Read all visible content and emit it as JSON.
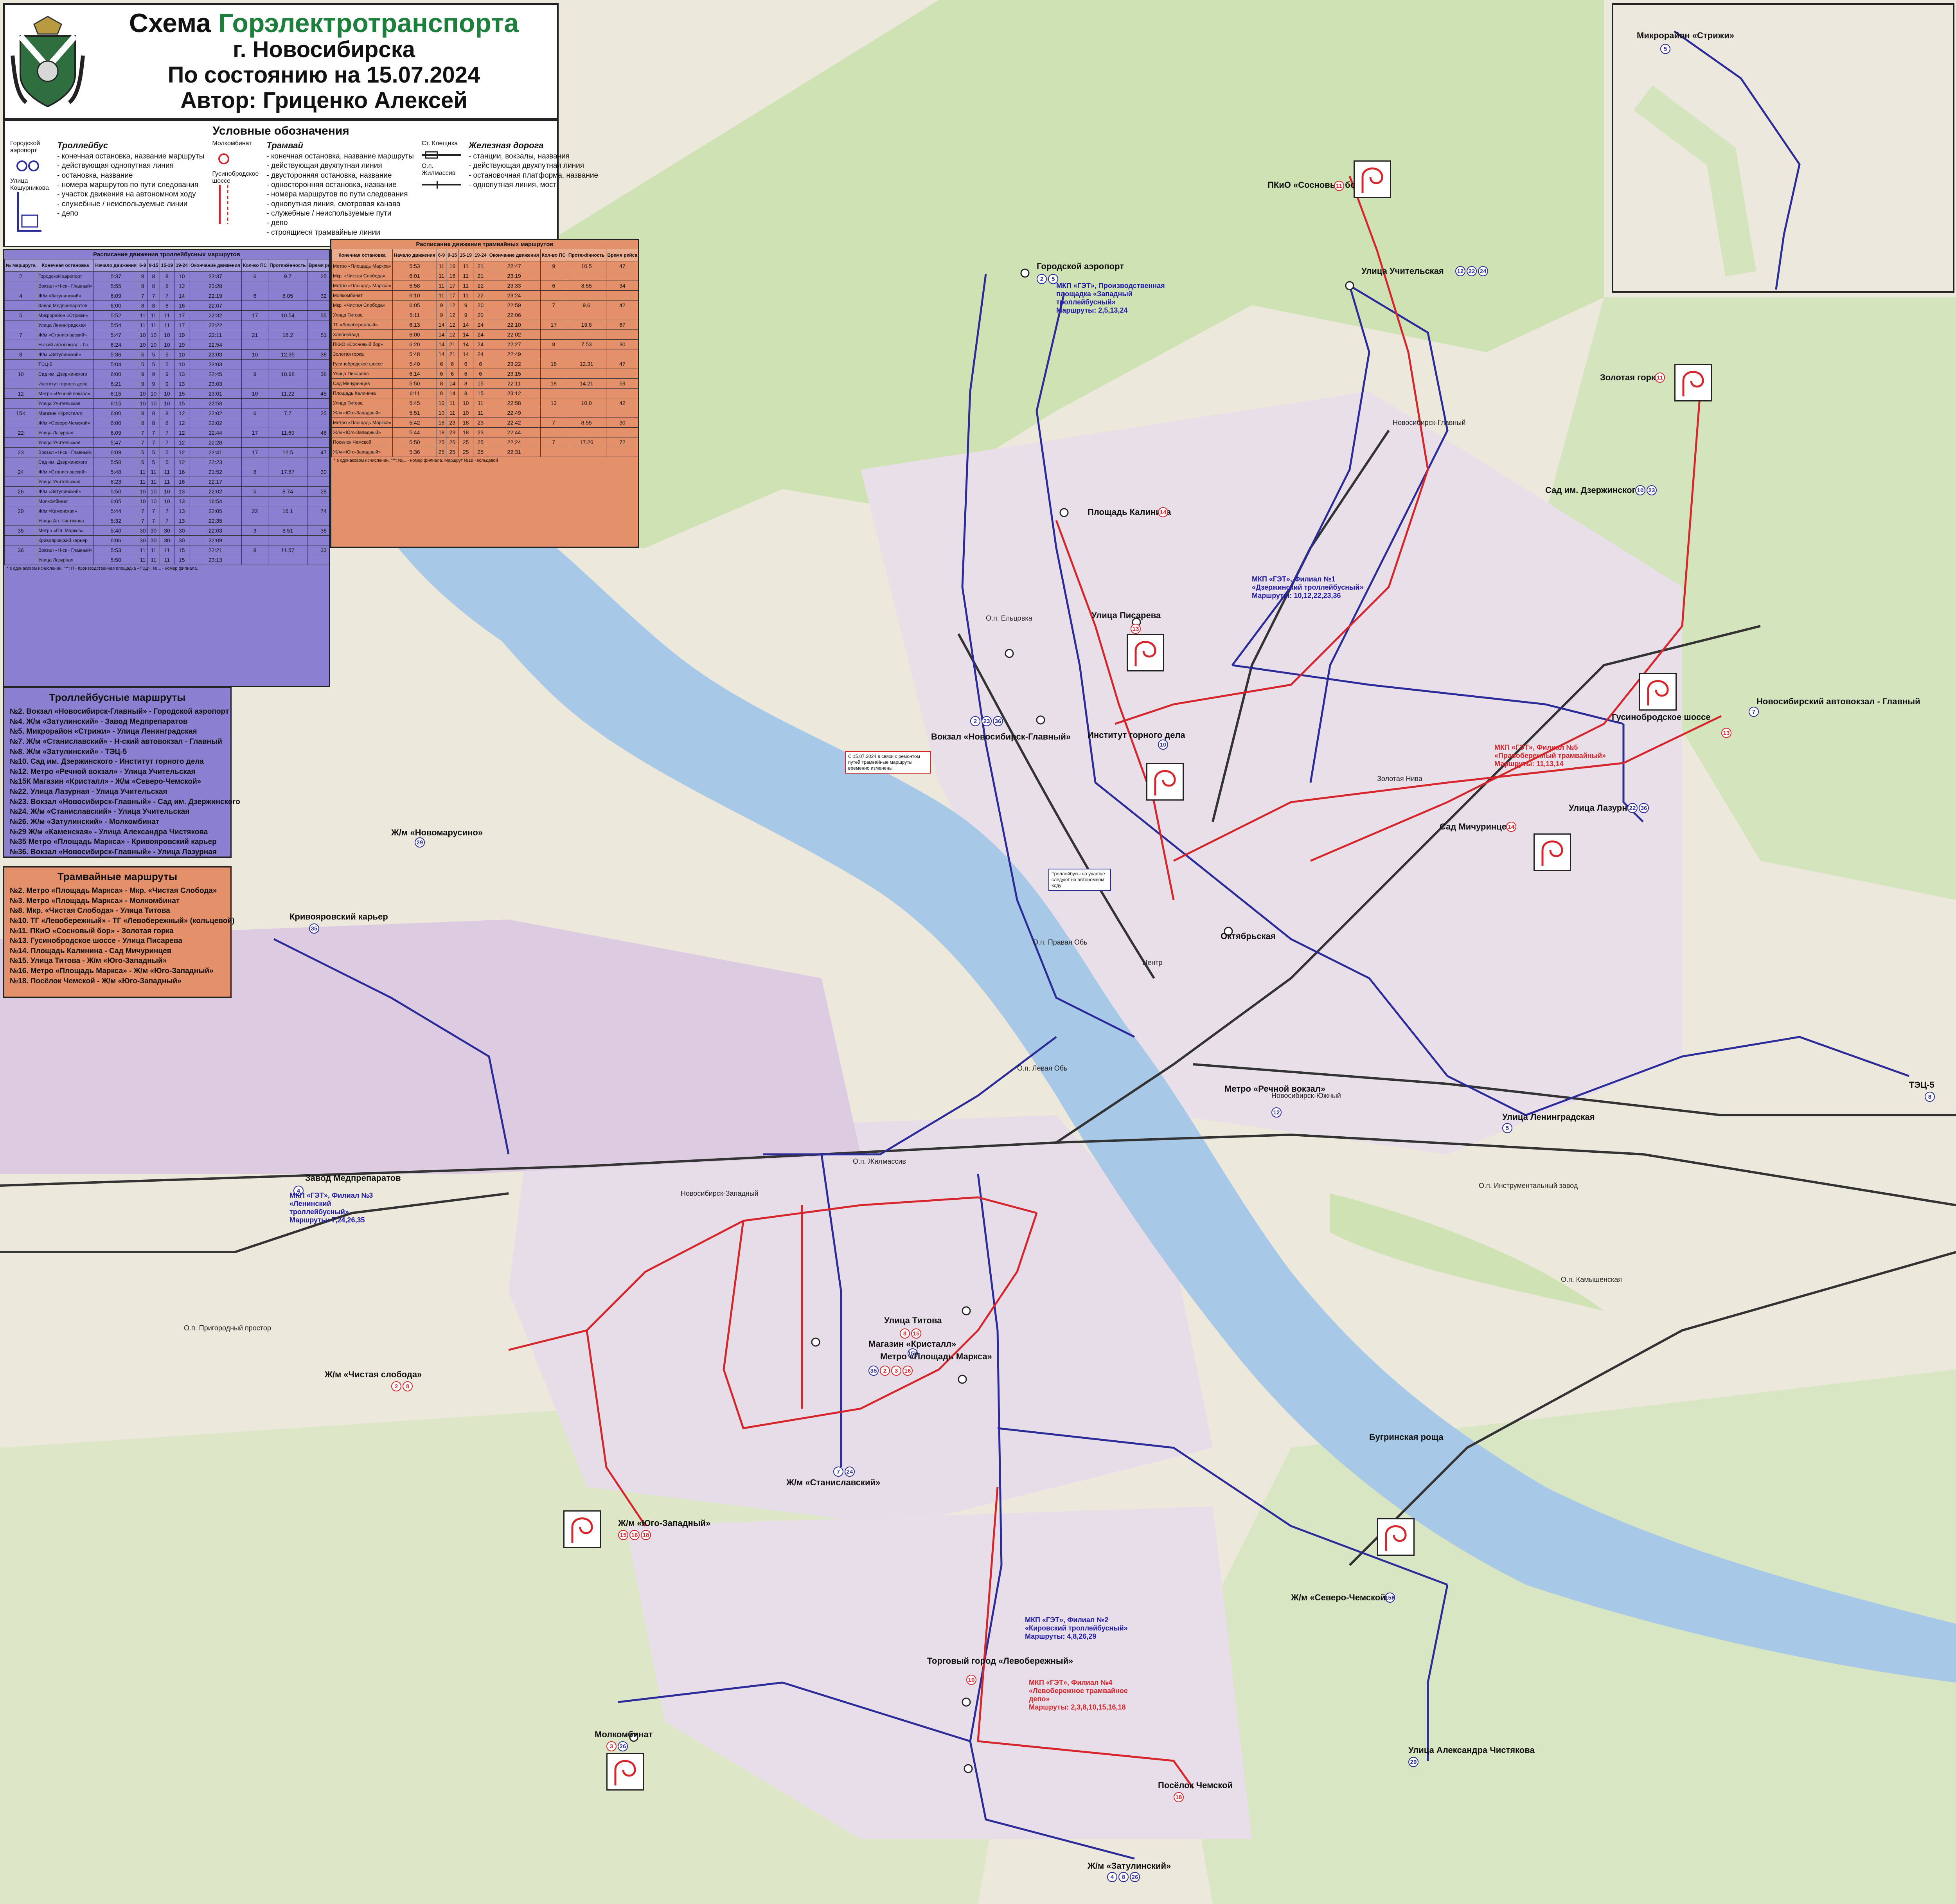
{
  "title": {
    "line1_prefix": "Схема ",
    "line1_accent": "Горэлектротранспорта",
    "line2": "г. Новосибирска",
    "line3": "По состоянию на 15.07.2024",
    "line4": "Автор: Гриценко Алексей"
  },
  "legend": {
    "title": "Условные обозначения",
    "trolleybus": {
      "head": "Троллейбус",
      "items": [
        "- конечная остановка, название маршруты",
        "- действующая однопутная линия",
        "- остановка, название",
        "- номера маршрутов по пути следования",
        "- участок движения на автономном ходу",
        "- служебные / неиспользуемые линии",
        "- депо"
      ],
      "sample_stop": "Городской аэропорт",
      "sample_street": "Улица Кошурникова"
    },
    "tram": {
      "head": "Трамвай",
      "items": [
        "- конечная остановка, название маршруты",
        "- действующая двухпутная линия",
        "- двусторонняя остановка, название",
        "- односторонняя остановка, название",
        "- номера маршрутов по пути следования",
        "- однопутная линия, смотровая канава",
        "- служебные / неиспользуемые пути",
        "- депо",
        "- строящиеся трамвайные линии"
      ],
      "sample_stop": "Молкомбинат",
      "sample_street": "Гусинобродское шоссе"
    },
    "railway": {
      "head": "Железная дорога",
      "items": [
        "- станции, вокзалы, названия",
        "- действующая двухпутная линия",
        "- остановочная платформа, название",
        "- однопутная линия, мост"
      ],
      "sample_station": "Ст. Клещиха",
      "sample_platform": "О.п. Жилмассив"
    }
  },
  "trolley_schedule": {
    "title": "Расписание движения троллейбусных маршрутов",
    "headers": [
      "№ маршрута",
      "Конечная остановка",
      "Начало движения",
      "6-9",
      "9-15",
      "15-19",
      "19-24",
      "Окончание движения",
      "Кол-во ПС",
      "Протяжённость",
      "Время рейса",
      "Депо"
    ],
    "rows": [
      [
        "2",
        "Городской аэропорт",
        "5:37",
        "8",
        "8",
        "8",
        "10",
        "22:37",
        "6",
        "9.7",
        "25",
        "№1"
      ],
      [
        "",
        "Вокзал «Н-ск - Главный»",
        "5:55",
        "8",
        "8",
        "8",
        "12",
        "23:28",
        "",
        "",
        "",
        ""
      ],
      [
        "4",
        "Ж/м «Затулинский»",
        "6:09",
        "7",
        "7",
        "7",
        "14",
        "22:19",
        "6",
        "8.05",
        "32",
        "№4"
      ],
      [
        "",
        "Завод Медпрепаратов",
        "6:00",
        "8",
        "8",
        "8",
        "18",
        "22:07",
        "",
        "",
        "",
        ""
      ],
      [
        "5",
        "Микрорайон «Стрижи»",
        "5:52",
        "11",
        "11",
        "11",
        "17",
        "22:32",
        "17",
        "10.54",
        "55",
        "№3"
      ],
      [
        "",
        "Улица Ленинградская",
        "5:54",
        "11",
        "11",
        "11",
        "17",
        "22:22",
        "",
        "",
        "",
        ""
      ],
      [
        "7",
        "Ж/м «Станиславский»",
        "5:47",
        "10",
        "10",
        "10",
        "19",
        "22:11",
        "21",
        "18.2",
        "51",
        "№1"
      ],
      [
        "",
        "Н-ский автовокзал - Гл.",
        "6:24",
        "10",
        "10",
        "10",
        "19",
        "22:54",
        "",
        "",
        "",
        ""
      ],
      [
        "8",
        "Ж/м «Затулинский»",
        "5:36",
        "5",
        "5",
        "5",
        "10",
        "23:03",
        "10",
        "12.35",
        "38",
        "№4"
      ],
      [
        "",
        "ТЭЦ-5",
        "5:04",
        "5",
        "5",
        "5",
        "10",
        "22:03",
        "",
        "",
        "",
        ""
      ],
      [
        "10",
        "Сад им. Дзержинского",
        "6:00",
        "9",
        "9",
        "9",
        "13",
        "22:45",
        "9",
        "10.98",
        "38",
        "№2"
      ],
      [
        "",
        "Институт горного дела",
        "6:21",
        "9",
        "9",
        "9",
        "13",
        "23:03",
        "",
        "",
        "",
        ""
      ],
      [
        "12",
        "Метро «Речной вокзал»",
        "6:15",
        "10",
        "10",
        "10",
        "15",
        "23:01",
        "10",
        "11.22",
        "45",
        "№3"
      ],
      [
        "",
        "Улица Учительская",
        "6:15",
        "10",
        "10",
        "10",
        "15",
        "22:58",
        "",
        "",
        "",
        ""
      ],
      [
        "15К",
        "Магазин «Кристалл»",
        "6:00",
        "8",
        "8",
        "8",
        "12",
        "22:02",
        "6",
        "7.7",
        "25",
        "№1"
      ],
      [
        "",
        "Ж/м «Северо-Чемской»",
        "6:00",
        "8",
        "8",
        "8",
        "12",
        "22:02",
        "",
        "",
        "",
        ""
      ],
      [
        "22",
        "Улица Лазурная",
        "6:09",
        "7",
        "7",
        "7",
        "12",
        "22:44",
        "17",
        "11.69",
        "46",
        "№2"
      ],
      [
        "",
        "Улица Учительская",
        "5:47",
        "7",
        "7",
        "7",
        "12",
        "22:28",
        "",
        "",
        "",
        ""
      ],
      [
        "23",
        "Вокзал «Н-ск - Главный»",
        "6:09",
        "5",
        "5",
        "5",
        "12",
        "22:41",
        "17",
        "12.5",
        "47",
        "№2"
      ],
      [
        "",
        "Сад им. Дзержинского",
        "5:58",
        "5",
        "5",
        "5",
        "12",
        "22:23",
        "",
        "",
        "",
        ""
      ],
      [
        "24",
        "Ж/м «Станиславский»",
        "5:48",
        "11",
        "11",
        "11",
        "16",
        "21:52",
        "8",
        "17.67",
        "30",
        "№1"
      ],
      [
        "",
        "Улица Учительская",
        "6:23",
        "11",
        "11",
        "11",
        "16",
        "22:17",
        "",
        "",
        "",
        ""
      ],
      [
        "26",
        "Ж/м «Затулинский»",
        "5:50",
        "10",
        "10",
        "10",
        "13",
        "22:02",
        "5",
        "8.74",
        "28",
        "№2"
      ],
      [
        "",
        "Молкомбинат",
        "6:05",
        "10",
        "10",
        "10",
        "13",
        "16:54",
        "",
        "",
        "",
        ""
      ],
      [
        "29",
        "Ж/м «Каменская»",
        "5:44",
        "7",
        "7",
        "7",
        "13",
        "22:05",
        "22",
        "16.1",
        "74",
        "№3"
      ],
      [
        "",
        "Улица Ал. Чистякова",
        "5:32",
        "7",
        "7",
        "7",
        "13",
        "22:35",
        "",
        "",
        "",
        ""
      ],
      [
        "35",
        "Метро «Пл. Маркса»",
        "5:40",
        "30",
        "30",
        "30",
        "30",
        "22:03",
        "3",
        "8.51",
        "38",
        "№4"
      ],
      [
        "",
        "Кривояровский карьер",
        "6:06",
        "30",
        "30",
        "30",
        "30",
        "22:09",
        "",
        "",
        "",
        ""
      ],
      [
        "36",
        "Вокзал «Н-ск - Главный»",
        "5:53",
        "11",
        "11",
        "11",
        "15",
        "22:21",
        "8",
        "11.57",
        "33",
        "№2"
      ],
      [
        "",
        "Улица Лазурная",
        "5:50",
        "11",
        "11",
        "11",
        "15",
        "23:13",
        "",
        "",
        "",
        ""
      ]
    ],
    "note": "* в одинаковом исчислении, \"*\": П - производственная площадка «ТЭД», №... - номер филиала."
  },
  "tram_schedule": {
    "title": "Расписание движения трамвайных маршрутов",
    "headers": [
      "Конечная остановка",
      "Начало движения",
      "6-9",
      "9-15",
      "15-19",
      "19-24",
      "Окончание движения",
      "Кол-во ПС",
      "Протяжённость",
      "Время рейса",
      "Депо"
    ],
    "rows": [
      [
        "Метро «Площадь Маркса»",
        "5:53",
        "11",
        "16",
        "11",
        "21",
        "22:47",
        "9",
        "10.5",
        "47",
        "№4"
      ],
      [
        "Мкр. «Чистая Слобода»",
        "6:01",
        "11",
        "16",
        "11",
        "21",
        "23:19",
        "",
        "",
        "",
        ""
      ],
      [
        "Метро «Площадь Маркса»",
        "5:58",
        "11",
        "17",
        "11",
        "22",
        "23:33",
        "6",
        "8.55",
        "34",
        "№4"
      ],
      [
        "Молкомбинат",
        "6:10",
        "11",
        "17",
        "11",
        "22",
        "23:24",
        "",
        "",
        "",
        ""
      ],
      [
        "Мкр. «Чистая Слобода»",
        "6:05",
        "9",
        "12",
        "9",
        "20",
        "22:59",
        "7",
        "9.6",
        "42",
        "№4"
      ],
      [
        "Улица Титова",
        "6:11",
        "9",
        "12",
        "9",
        "20",
        "22:06",
        "",
        "",
        "",
        ""
      ],
      [
        "ТГ «Левобережный»",
        "6:13",
        "14",
        "12",
        "14",
        "24",
        "22:10",
        "17",
        "19.8",
        "67",
        "№4"
      ],
      [
        "Хлебозавод",
        "6:00",
        "14",
        "12",
        "14",
        "24",
        "22:02",
        "",
        "",
        "",
        ""
      ],
      [
        "ПКиО «Сосновый бор»",
        "6:20",
        "14",
        "21",
        "14",
        "24",
        "22:27",
        "8",
        "7.53",
        "30",
        "№5"
      ],
      [
        "Золотая горка",
        "5:48",
        "14",
        "21",
        "14",
        "24",
        "22:49",
        "",
        "",
        "",
        ""
      ],
      [
        "Гусинобродское шоссе",
        "5:40",
        "6",
        "6",
        "6",
        "6",
        "23:22",
        "18",
        "12.31",
        "47",
        "№5"
      ],
      [
        "Улица Писарева",
        "6:14",
        "6",
        "6",
        "6",
        "6",
        "23:15",
        "",
        "",
        "",
        ""
      ],
      [
        "Сад Мичуринцев",
        "5:50",
        "8",
        "14",
        "8",
        "15",
        "22:11",
        "18",
        "14.21",
        "59",
        "№5"
      ],
      [
        "Площадь Калинина",
        "6:11",
        "8",
        "14",
        "8",
        "15",
        "23:12",
        "",
        "",
        "",
        ""
      ],
      [
        "Улица Титова",
        "5:45",
        "10",
        "11",
        "10",
        "11",
        "22:58",
        "13",
        "10.0",
        "42",
        "№4"
      ],
      [
        "Ж/м «Юго-Западный»",
        "5:51",
        "10",
        "11",
        "10",
        "11",
        "22:49",
        "",
        "",
        "",
        ""
      ],
      [
        "Метро «Площадь Маркса»",
        "5:42",
        "18",
        "23",
        "18",
        "23",
        "22:42",
        "7",
        "8.55",
        "30",
        "№4"
      ],
      [
        "Ж/м «Юго-Западный»",
        "5:44",
        "18",
        "23",
        "18",
        "23",
        "22:44",
        "",
        "",
        "",
        ""
      ],
      [
        "Посёлок Чемской",
        "5:50",
        "25",
        "25",
        "25",
        "25",
        "22:24",
        "7",
        "17.26",
        "72",
        "№4"
      ],
      [
        "Ж/м «Юго-Западный»",
        "5:36",
        "25",
        "25",
        "25",
        "25",
        "22:31",
        "",
        "",
        "",
        ""
      ]
    ],
    "note": "* в одинаковом исчислении, \"*\": №... - номер филиала. Маршрут №18 - кольцевой"
  },
  "trolley_routes": {
    "head": "Троллейбусные маршруты",
    "items": [
      "№2. Вокзал «Новосибирск-Главный» - Городской аэропорт",
      "№4. Ж/м «Затулинский» - Завод Медпрепаратов",
      "№5. Микрорайон «Стрижи» - Улица Ленинградская",
      "№7. Ж/м «Станиславский» - Н-ский автовокзал - Главный",
      "№8. Ж/м «Затулинский» - ТЭЦ-5",
      "№10. Сад им. Дзержинского - Институт горного дела",
      "№12. Метро «Речной вокзал» - Улица Учительская",
      "№15К Магазин «Кристалл» - Ж/м «Северо-Чемской»",
      "№22. Улица Лазурная - Улица Учительская",
      "№23. Вокзал «Новосибирск-Главный» - Сад им. Дзержинского",
      "№24. Ж/м «Станиславский» - Улица Учительская",
      "№26. Ж/м «Затулинский» - Молкомбинат",
      "№29 Ж/м «Каменская» - Улица Александра Чистякова",
      "№35 Метро «Площадь Маркса» - Кривояровский карьер",
      "№36. Вокзал «Новосибирск-Главный» - Улица Лазурная"
    ]
  },
  "tram_routes": {
    "head": "Трамвайные маршруты",
    "items": [
      "№2. Метро «Площадь Маркса» - Мкр. «Чистая Слобода»",
      "№3. Метро «Площадь Маркса» - Молкомбинат",
      "№8. Мкр. «Чистая Слобода» - Улица Титова",
      "№10. ТГ «Левобережный» - ТГ «Левобережный» (кольцевой)",
      "№11. ПКиО «Сосновый бор» - Золотая горка",
      "№13. Гусинобродское шоссе - Улица Писарева",
      "№14. Площадь Калинина - Сад Мичуринцев",
      "№15. Улица Титова - Ж/м «Юго-Западный»",
      "№16. Метро «Площадь Маркса» - Ж/м «Юго-Западный»",
      "№18. Посёлок Чемской - Ж/м «Юго-Западный»"
    ]
  },
  "map": {
    "water_names": [],
    "stops": {
      "airport": "Городской аэропорт",
      "uchitelskaya": "Улица Учительская",
      "sosnovy_bor": "ПКиО «Сосновый бор»",
      "zolotaya_gorka": "Золотая горка",
      "sad_dzerzhinskogo": "Сад им. Дзержинского",
      "ploshchad_kalinina": "Площадь Калинина",
      "ulitsa_pisareva": "Улица Писарева",
      "gusinobrodskoe": "Гусинобродское шоссе",
      "nsk_autovokzal": "Новосибирский автовокзал - Главный",
      "ulitsa_lazurnaya": "Улица Лазурная",
      "sad_michurintsev": "Сад Мичуринцев",
      "institut_gornogo_dela": "Институт горного дела",
      "vokzal_glavny": "Вокзал «Новосибирск-Главный»",
      "zhm_novomarusino": "Ж/м «Новомарусино»",
      "krivoyarovsky": "Кривояровский карьер",
      "zavod_medpreparatov": "Завод Медпрепаратов",
      "zhm_chistaya_sloboda": "Ж/м «Чистая слобода»",
      "ulitsa_titova": "Улица Титова",
      "magazin_kristall": "Магазин «Кристалл»",
      "metro_ploshchad_marksa": "Метро «Площадь Маркса»",
      "zhm_stanislavsky": "Ж/м «Станиславский»",
      "zhm_yugo_zapadny": "Ж/м «Юго-Западный»",
      "molkombinat": "Молкомбинат",
      "torgovy_gorodok": "Торговый город «Левобережный»",
      "poselok_chemskoy": "Посёлок Чемской",
      "zhm_zatulinsky": "Ж/м «Затулинский»",
      "zhm_severo_chemskoy": "Ж/м «Северо-Чемской»",
      "ulitsa_chistyakova": "Улица Александра Чистякова",
      "ulitsa_leningradskaya": "Улица Ленинградская",
      "tets5": "ТЭЦ-5",
      "mkr_strizhi": "Микрорайон «Стрижи»",
      "oktyabrskaya": "Октябрьская",
      "rechnoy_vokzal": "Метро «Речной вокзал»",
      "butyrskaya_roshcha": "Бугринская роща"
    },
    "rail": {
      "station_glavny": "Новосибирск-Главный",
      "station_yuzhny": "Новосибирск-Южный",
      "station_zapadny": "Новосибирск-Западный",
      "op_levaya_ob": "О.п. Левая Обь",
      "op_pravaya_ob": "О.п. Правая Обь",
      "op_zhilmassiv": "О.п. Жилмассив",
      "op_prigorodny": "О.п. Пригородный простор",
      "op_zolotaya_niva": "Золотая Нива",
      "op_instrumentalny": "О.п. Инструментальный завод",
      "op_kamyshenskaya": "О.п. Камышенская",
      "op_yeltsovka": "О.п. Ельцовка",
      "op_tsentr": "Центр"
    },
    "depots": {
      "depot1": "МКП «ГЭТ», Производственная площадка «Западный троллейбусный»",
      "depot1_addr": "Маршруты: 2,5,13,24",
      "depot2": "МКП «ГЭТ», Филиал №2 «Кировский троллейбусный»",
      "depot2_routes": "Маршруты: 4,8,26,29",
      "depot3": "МКП «ГЭТ», Филиал №3 «Ленинский троллейбусный»",
      "depot3_routes": "Маршруты: 7,24,26,35",
      "depot4_tram": "МКП «ГЭТ», Филиал №4 «Левобережное трамвайное депо»",
      "depot4_routes": "Маршруты: 2,3,8,10,15,16,18",
      "depot5_tram": "МКП «ГЭТ», Филиал №5 «Правобережный трамвайный»",
      "depot5_routes": "Маршруты: 11,13,14",
      "depot_dzerzhinsky": "МКП «ГЭТ», Филиал №1 «Дзержинский троллейбусный»",
      "depot_dzerzhinsky_routes": "Маршруты: 10,12,22,23,36"
    },
    "badges": {
      "airport": [
        "2",
        "5"
      ],
      "uchitelskaya": [
        "12",
        "22",
        "24"
      ],
      "sosnovy_bor": [
        "11"
      ],
      "zolotaya_gorka": [
        "11"
      ],
      "sad_dzerzhinskogo": [
        "10",
        "23"
      ],
      "ploshchad_kalinina": [
        "14"
      ],
      "pisareva": [
        "13"
      ],
      "gusinobrodskoe": [
        "13"
      ],
      "nsk_autovokzal": [
        "7"
      ],
      "lazurnaya": [
        "22",
        "36"
      ],
      "michurintsev": [
        "14"
      ],
      "institut": [
        "10"
      ],
      "vokzal_glavny": [
        "2",
        "23",
        "36"
      ],
      "novomarusino": [
        "29"
      ],
      "krivoyarovsky": [
        "35"
      ],
      "medpreparatov": [
        "4"
      ],
      "chistaya_sloboda": [
        "2",
        "8"
      ],
      "titova": [
        "8",
        "15"
      ],
      "kristall": [
        "15К"
      ],
      "marksa": [
        "35",
        "2",
        "3",
        "16"
      ],
      "stanislavsky": [
        "7",
        "24"
      ],
      "yugo_zapadny": [
        "15",
        "16",
        "18"
      ],
      "molkombinat": [
        "3",
        "26"
      ],
      "torgovy": [
        "10"
      ],
      "chemskoy": [
        "18"
      ],
      "zatulinsky": [
        "4",
        "8",
        "26"
      ],
      "severo_chemskoy": [
        "15К"
      ],
      "chistyakova": [
        "29"
      ],
      "leningradskaya": [
        "5"
      ],
      "tets5": [
        "8"
      ],
      "strizhi": [
        "5"
      ],
      "rechnoy": [
        "12"
      ]
    },
    "notebox_text": "С 15.07.2024 в связи с ремонтом путей трамвайные маршруты временно изменены",
    "notebox2_text": "Троллейбусы на участке следуют на автономном ходу"
  },
  "colors": {
    "trolley": "#2b2b9a",
    "tram": "#d6262b",
    "water": "#a7c8e6",
    "green": "#cfe2b4",
    "industrial": "#dcc9e0",
    "residential": "#e8dfe9",
    "trolley_schedule_bg": "#8a7fd0",
    "tram_schedule_bg": "#e4906a",
    "title_accent": "#1e7f3c"
  }
}
